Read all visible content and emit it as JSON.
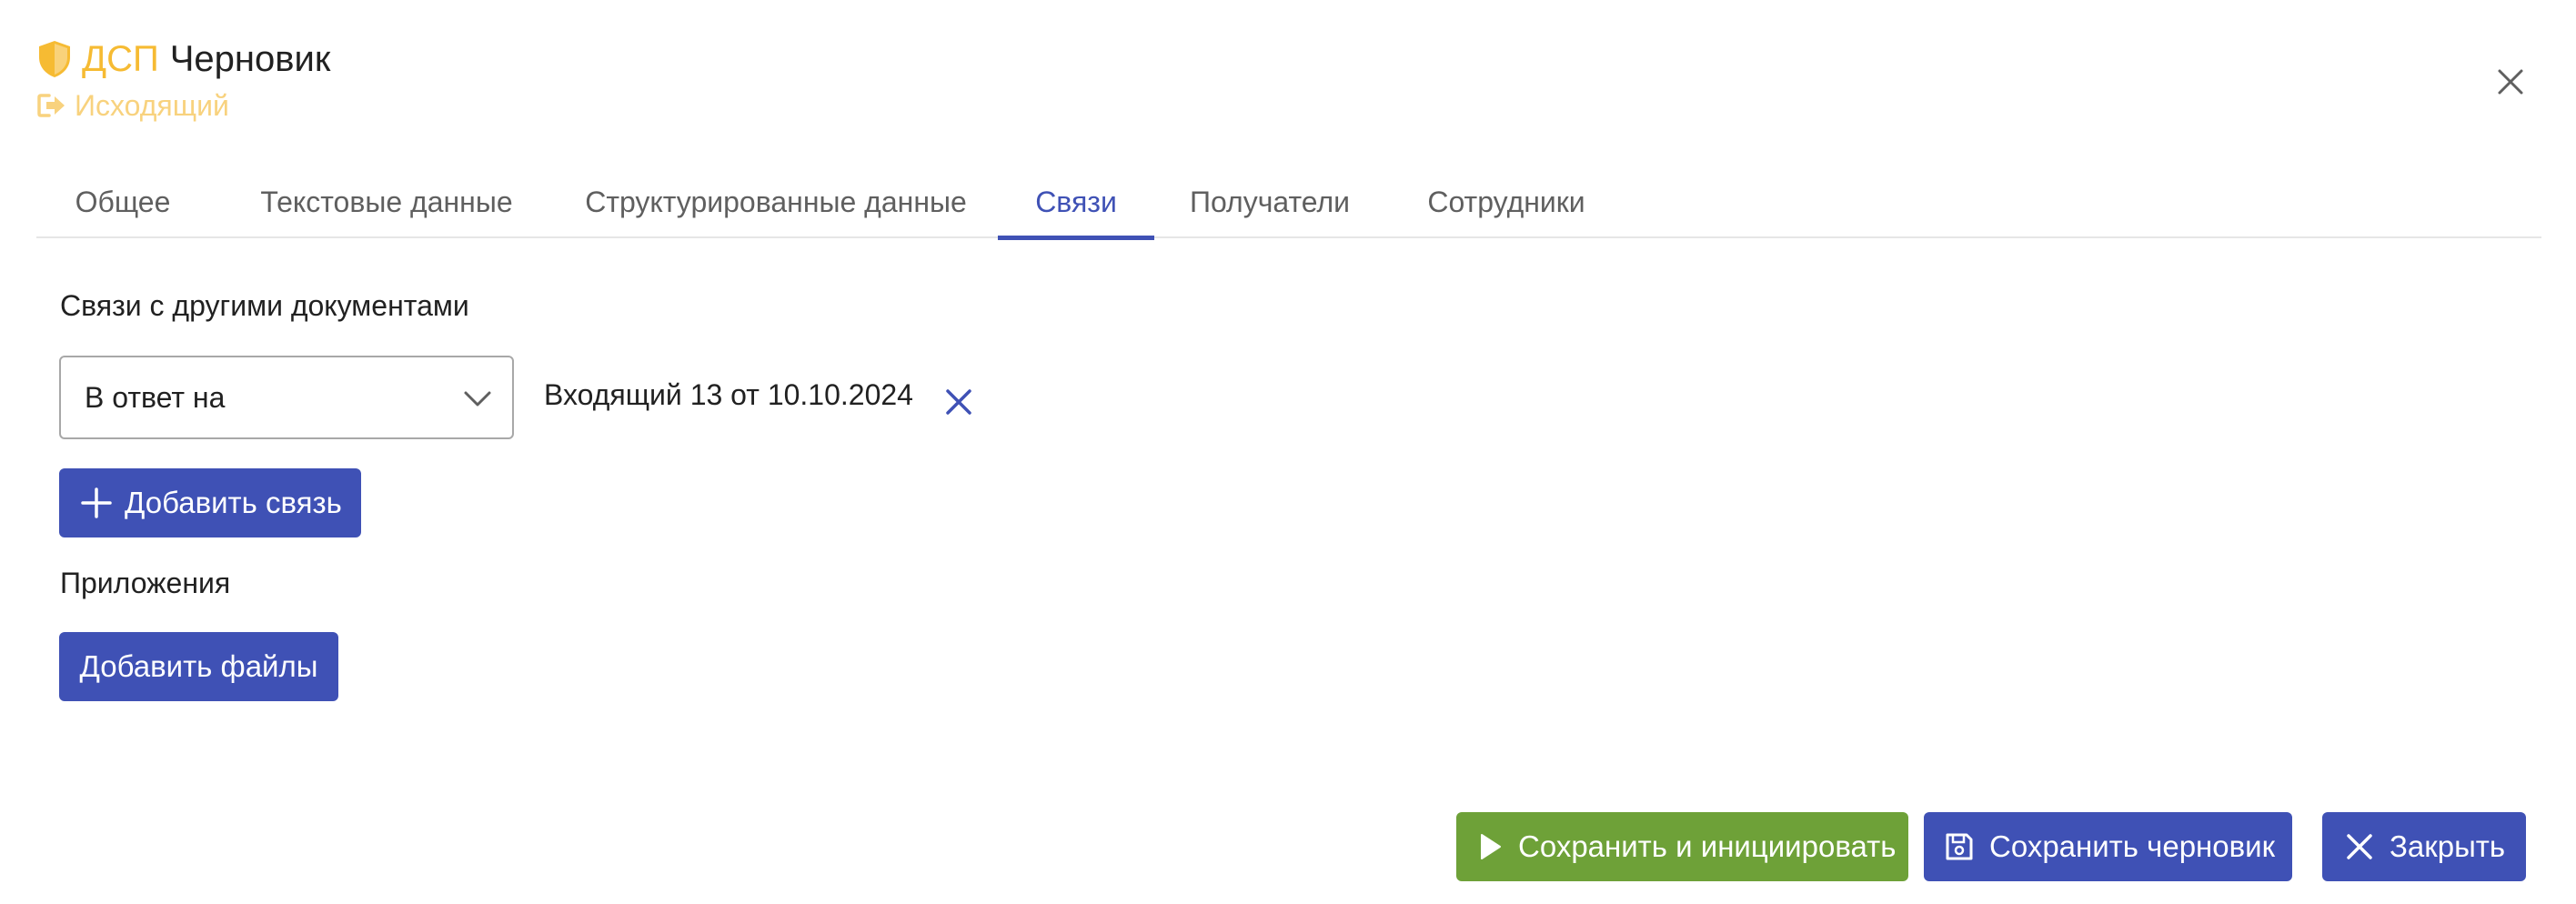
{
  "header": {
    "classification": "ДСП",
    "status": "Черновик",
    "direction": "Исходящий",
    "classification_icon": "shield-icon",
    "direction_icon": "sign-out-icon",
    "close_icon": "close-icon"
  },
  "tabs": [
    {
      "label": "Общее",
      "active": false
    },
    {
      "label": "Текстовые данные",
      "active": false
    },
    {
      "label": "Структурированные данные",
      "active": false
    },
    {
      "label": "Связи",
      "active": true
    },
    {
      "label": "Получатели",
      "active": false
    },
    {
      "label": "Сотрудники",
      "active": false
    }
  ],
  "links": {
    "section_label": "Связи с другими документами",
    "items": [
      {
        "relation_type": "В ответ на",
        "document": "Входящий 13 от 10.10.2024"
      }
    ],
    "add_button_label": "Добавить связь"
  },
  "attachments": {
    "section_label": "Приложения",
    "add_button_label": "Добавить файлы"
  },
  "footer": {
    "save_and_initiate_label": "Сохранить и инициировать",
    "save_draft_label": "Сохранить черновик",
    "close_label": "Закрыть"
  },
  "colors": {
    "accent": "#3f51b5",
    "success": "#6ea138",
    "classification": "#f6bb33",
    "direction": "#f8d27e"
  }
}
